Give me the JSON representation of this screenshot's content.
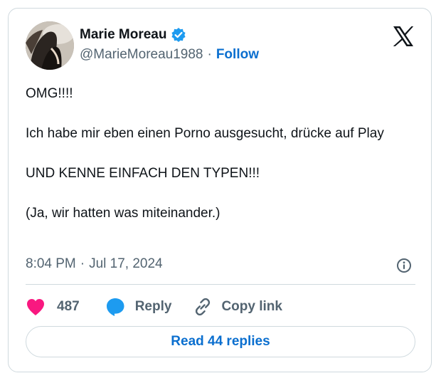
{
  "author": {
    "name": "Marie Moreau",
    "handle": "@MarieMoreau1988",
    "separator": "·",
    "follow_label": "Follow",
    "verified": true,
    "verified_color": "#1d9bf0"
  },
  "tweet": {
    "lines": [
      "OMG!!!!",
      "Ich habe mir eben einen Porno ausgesucht, drücke auf Play",
      "UND KENNE EINFACH DEN TYPEN!!!",
      "(Ja, wir hatten was miteinander.)"
    ],
    "time": "8:04 PM",
    "date_separator": "·",
    "date": "Jul 17, 2024"
  },
  "actions": {
    "like_count": "487",
    "like_color": "#f91880",
    "reply_label": "Reply",
    "reply_color": "#1d9bf0",
    "copy_link_label": "Copy link"
  },
  "read_replies_label": "Read 44 replies",
  "icons": {
    "platform": "x-logo-icon",
    "verified": "verified-badge-icon",
    "info": "info-icon",
    "like": "heart-icon",
    "reply": "speech-bubble-icon",
    "copy": "link-icon"
  },
  "colors": {
    "accent": "#0b6fcf",
    "secondary_text": "#536471",
    "border": "#cfd9de"
  }
}
